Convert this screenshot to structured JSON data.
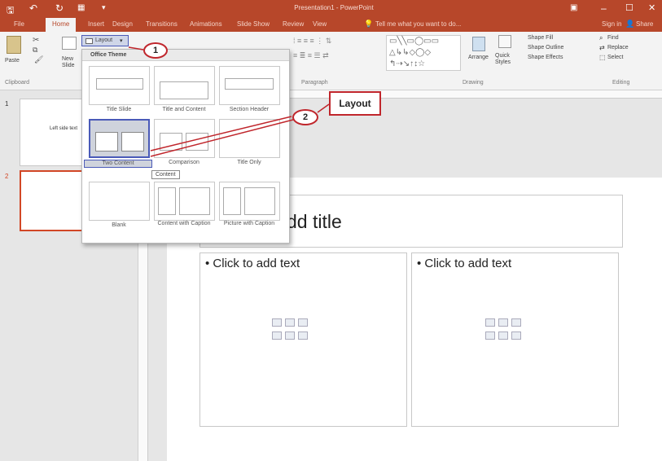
{
  "window": {
    "title": "Presentation1 - PowerPoint",
    "min": "–",
    "max": "☐",
    "close": "✕",
    "signin": "Sign in",
    "share": "Share"
  },
  "tabs": [
    "File",
    "Home",
    "Insert",
    "Design",
    "Transitions",
    "Animations",
    "Slide Show",
    "Review",
    "View"
  ],
  "tell_me": "Tell me what you want to do...",
  "ribbon": {
    "paste": "Paste",
    "new_slide": "New Slide",
    "layout": "Layout",
    "clipboard": "Clipboard",
    "paragraph": "Paragraph",
    "drawing": "Drawing",
    "editing": "Editing",
    "arrange": "Arrange",
    "quick_styles": "Quick Styles",
    "shape_fill": "Shape Fill",
    "shape_outline": "Shape Outline",
    "shape_effects": "Shape Effects",
    "find": "Find",
    "replace": "Replace",
    "select": "Select"
  },
  "gallery": {
    "header": "Office Theme",
    "layouts": [
      "Title Slide",
      "Title and Content",
      "Section Header",
      "Two Content",
      "Comparison",
      "Title Only",
      "Blank",
      "Content with Caption",
      "Picture with Caption"
    ],
    "tooltip": "Content"
  },
  "thumbs": {
    "slide1_num": "1",
    "slide1_text": "Left side text",
    "slide2_num": "2"
  },
  "slide": {
    "title": "dd title",
    "left_text": "Click to add text",
    "right_text": "Click to add text"
  },
  "callouts": {
    "one": "1",
    "two": "2",
    "layout": "Layout"
  },
  "colors": {
    "accent": "#b7472a",
    "callout": "#c0262c",
    "selection": "#4a5ab8"
  }
}
